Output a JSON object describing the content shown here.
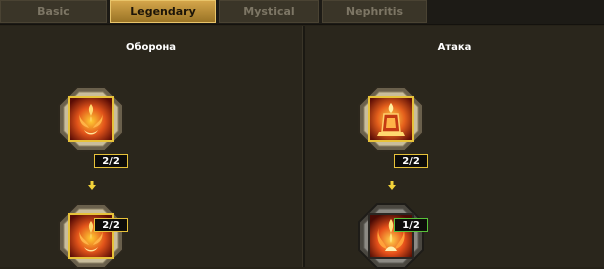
{
  "tabs": [
    {
      "label": "Basic",
      "active": false
    },
    {
      "label": "Legendary",
      "active": true
    },
    {
      "label": "Mystical",
      "active": false
    },
    {
      "label": "Nephritis",
      "active": false
    }
  ],
  "panels": {
    "left": {
      "title": "Оборона",
      "nodes": [
        {
          "icon": "flame-flower-icon",
          "rank": "2/2",
          "status": "maxed"
        },
        {
          "icon": "flame-flower-icon",
          "rank": "2/2",
          "status": "maxed"
        }
      ]
    },
    "right": {
      "title": "Атака",
      "nodes": [
        {
          "icon": "flame-statue-icon",
          "rank": "2/2",
          "status": "maxed"
        },
        {
          "icon": "flame-burst-icon",
          "rank": "1/2",
          "status": "upgradable"
        }
      ]
    }
  },
  "colors": {
    "accent_gold": "#e7c23a",
    "upgradable_green": "#58c23a",
    "background": "#2a261c"
  }
}
